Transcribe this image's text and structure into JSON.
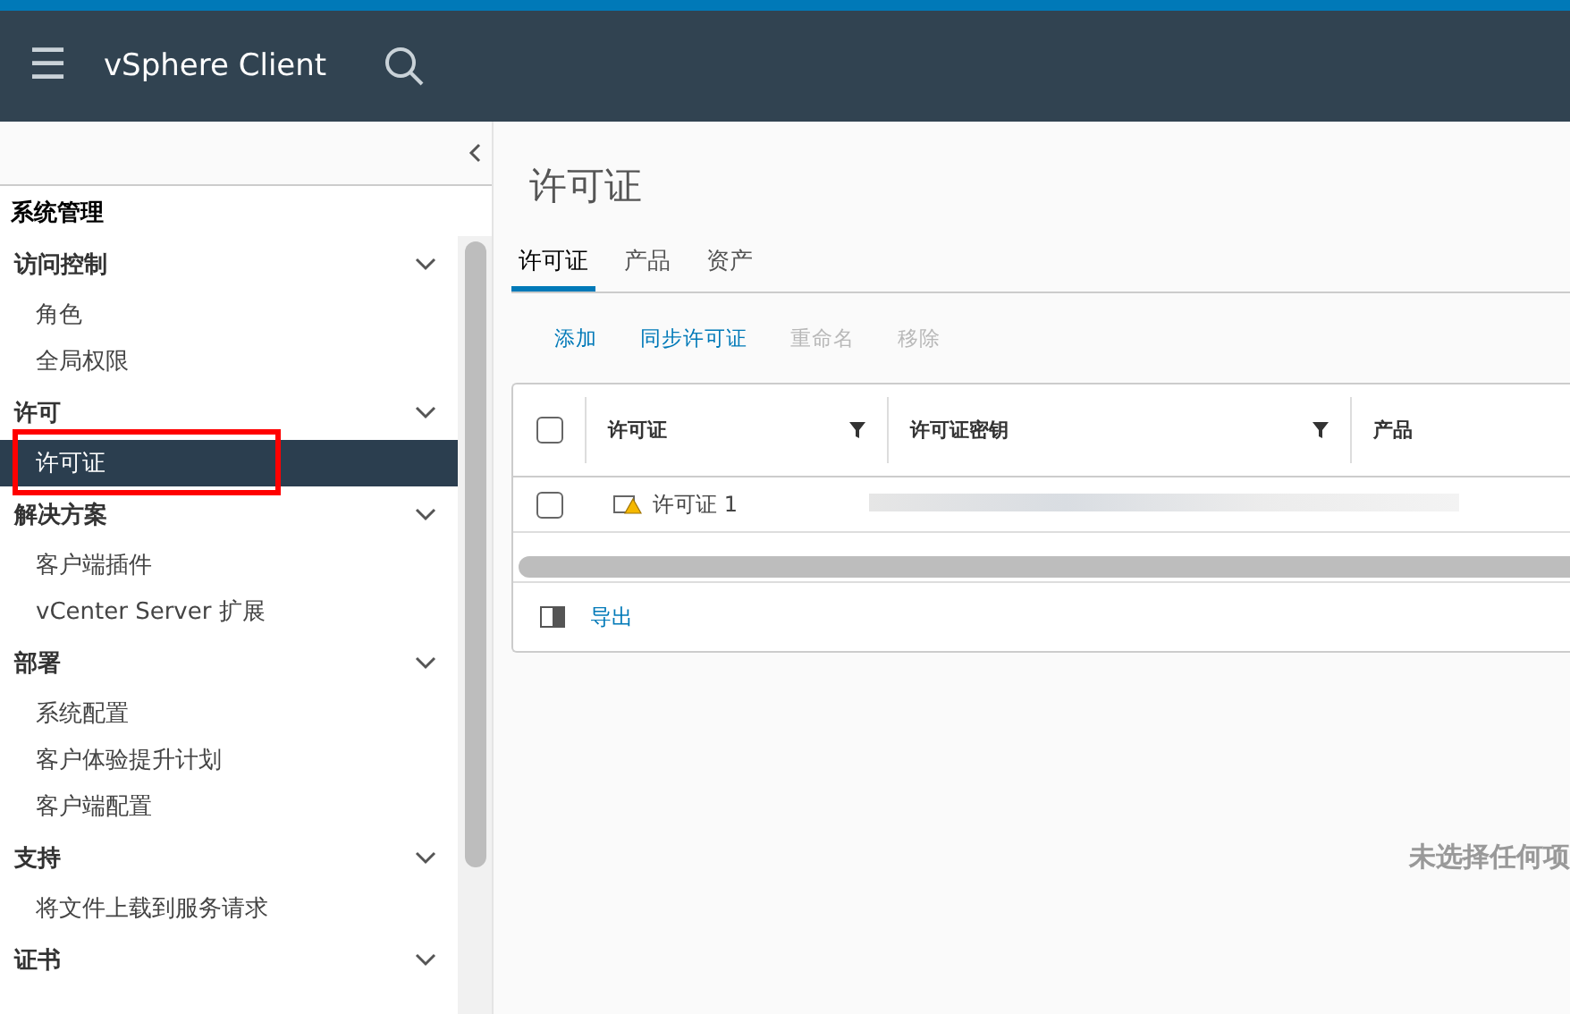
{
  "header": {
    "menu_icon": "☰",
    "title": "vSphere Client"
  },
  "sidebar": {
    "title": "系统管理",
    "groups": [
      {
        "label": "访问控制",
        "expanded": true,
        "children": [
          {
            "label": "角色",
            "selected": false
          },
          {
            "label": "全局权限",
            "selected": false
          }
        ]
      },
      {
        "label": "许可",
        "expanded": true,
        "children": [
          {
            "label": "许可证",
            "selected": true,
            "highlighted": true
          }
        ]
      },
      {
        "label": "解决方案",
        "expanded": true,
        "children": [
          {
            "label": "客户端插件",
            "selected": false
          },
          {
            "label": "vCenter Server 扩展",
            "selected": false
          }
        ]
      },
      {
        "label": "部署",
        "expanded": true,
        "children": [
          {
            "label": "系统配置",
            "selected": false
          },
          {
            "label": "客户体验提升计划",
            "selected": false
          },
          {
            "label": "客户端配置",
            "selected": false
          }
        ]
      },
      {
        "label": "支持",
        "expanded": true,
        "children": [
          {
            "label": "将文件上载到服务请求",
            "selected": false
          }
        ]
      },
      {
        "label": "证书",
        "expanded": true
      }
    ]
  },
  "page_title": "许可证",
  "tabs": [
    {
      "label": "许可证",
      "selected": true
    },
    {
      "label": "产品",
      "selected": false
    },
    {
      "label": "资产",
      "selected": false
    }
  ],
  "actions": [
    {
      "label": "添加",
      "disabled": false
    },
    {
      "label": "同步许可证",
      "disabled": false
    },
    {
      "label": "重命名",
      "disabled": true
    },
    {
      "label": "移除",
      "disabled": true
    }
  ],
  "table": {
    "columns": [
      {
        "label": "许可证",
        "filter": true
      },
      {
        "label": "许可证密钥",
        "filter": true
      },
      {
        "label": "产品"
      }
    ],
    "all_checked": false,
    "rows": [
      {
        "name": "许可证 1",
        "checked": false,
        "warning": true
      }
    ],
    "footer": {
      "export": "导出"
    }
  },
  "empty_message": "未选择任何项"
}
